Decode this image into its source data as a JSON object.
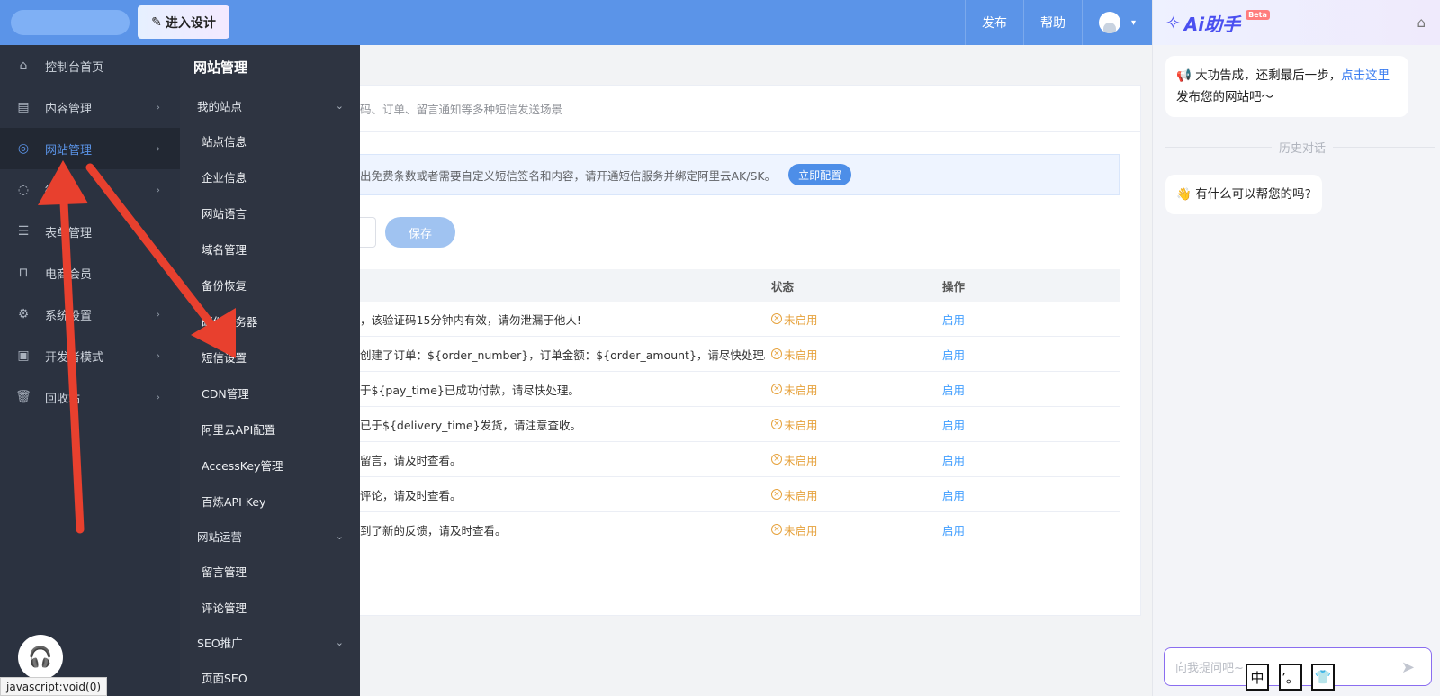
{
  "topbar": {
    "design_label": "进入设计",
    "publish": "发布",
    "help": "帮助"
  },
  "sidebar": {
    "items": [
      {
        "label": "控制台首页",
        "icon": "home-icon"
      },
      {
        "label": "内容管理",
        "icon": "document-icon"
      },
      {
        "label": "网站管理",
        "icon": "globe-icon"
      },
      {
        "label": "微...号",
        "icon": "wechat-icon"
      },
      {
        "label": "表单管理",
        "icon": "form-icon"
      },
      {
        "label": "电商会员",
        "icon": "shop-icon"
      },
      {
        "label": "系统设置",
        "icon": "gear-icon"
      },
      {
        "label": "开发者模式",
        "icon": "terminal-icon"
      },
      {
        "label": "回收站",
        "icon": "trash-icon"
      }
    ]
  },
  "submenu": {
    "title": "网站管理",
    "group1": "我的站点",
    "group1_items": [
      "站点信息",
      "企业信息",
      "网站语言",
      "域名管理",
      "备份恢复",
      "邮件服务器",
      "短信设置",
      "CDN管理",
      "阿里云API配置",
      "AccessKey管理",
      "百炼API Key"
    ],
    "group2": "网站运营",
    "group2_items": [
      "留言管理",
      "评论管理"
    ],
    "group3": "SEO推广",
    "group3_items": [
      "页面SEO"
    ]
  },
  "main": {
    "desc": "码、订单、留言通知等多种短信发送场景",
    "notice": "出免费条数或者需要自定义短信签名和内容，请开通短信服务并绑定阿里云AK/SK。",
    "config_btn": "立即配置",
    "save": "保存",
    "table": {
      "headers": {
        "status": "状态",
        "op": "操作"
      },
      "rows": [
        {
          "content": "，该验证码15分钟内有效，请勿泄漏于他人!",
          "status": "未启用",
          "op": "启用"
        },
        {
          "content": "创建了订单：${order_number}，订单金额：${order_amount}，请尽快处理。",
          "status": "未启用",
          "op": "启用"
        },
        {
          "content": "于${pay_time}已成功付款，请尽快处理。",
          "status": "未启用",
          "op": "启用"
        },
        {
          "content": "已于${delivery_time}发货，请注意查收。",
          "status": "未启用",
          "op": "启用"
        },
        {
          "content": "留言，请及时查看。",
          "status": "未启用",
          "op": "启用"
        },
        {
          "content": "评论，请及时查看。",
          "status": "未启用",
          "op": "启用"
        },
        {
          "content": "到了新的反馈，请及时查看。",
          "status": "未启用",
          "op": "启用"
        }
      ]
    }
  },
  "ai": {
    "title": "Ai助手",
    "beta": "Beta",
    "msg1_pre": "大功告成，还剩最后一步，",
    "msg1_link": "点击这里",
    "msg1_post": "发布您的网站吧～",
    "history": "历史对话",
    "msg2": "有什么可以帮您的吗?",
    "input_placeholder": "向我提问吧~"
  },
  "ime": [
    "中",
    "’。",
    "👕"
  ],
  "status_bar": "javascript:void(0)"
}
